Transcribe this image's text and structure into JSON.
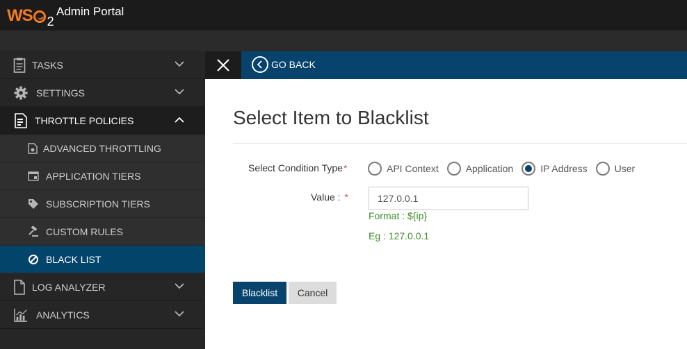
{
  "brand": {
    "logo_ws": "WS",
    "logo_2": "2",
    "portal_title": "Admin Portal",
    "accent": "#f47b20"
  },
  "sidebar": {
    "items": [
      {
        "label": "TASKS",
        "icon": "clipboard-icon"
      },
      {
        "label": "SETTINGS",
        "icon": "gear-icon"
      },
      {
        "label": "THROTTLE POLICIES",
        "icon": "throttle-document-icon",
        "expanded": true
      },
      {
        "label": "ADVANCED THROTTLING",
        "icon": "advanced-throttle-icon"
      },
      {
        "label": "APPLICATION TIERS",
        "icon": "window-icon"
      },
      {
        "label": "SUBSCRIPTION TIERS",
        "icon": "tag-icon"
      },
      {
        "label": "CUSTOM RULES",
        "icon": "gavel-icon"
      },
      {
        "label": "BLACK LIST",
        "icon": "ban-icon",
        "selected": true
      },
      {
        "label": "LOG ANALYZER",
        "icon": "file-icon"
      },
      {
        "label": "ANALYTICS",
        "icon": "bar-chart-icon"
      }
    ],
    "selected_color": "#03446b"
  },
  "panel": {
    "go_back_label": "GO BACK",
    "header_color": "#07436c"
  },
  "form": {
    "title": "Select Item to Blacklist",
    "condition_label": "Select Condition Type",
    "required_mark": "*",
    "options": [
      {
        "label": "API Context",
        "checked": false
      },
      {
        "label": "Application",
        "checked": false
      },
      {
        "label": "IP Address",
        "checked": true
      },
      {
        "label": "User",
        "checked": false
      }
    ],
    "value_label": "Value :",
    "value": "127.0.0.1",
    "format_hint": "Format : ${ip}",
    "example_hint": "Eg : 127.0.0.1",
    "submit_label": "Blacklist",
    "cancel_label": "Cancel"
  }
}
